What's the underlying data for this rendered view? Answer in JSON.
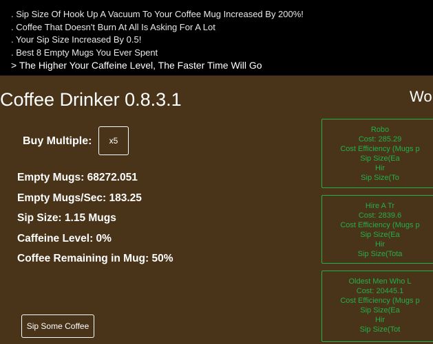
{
  "log": [
    ". Sip Size Of Hook Up A Vacuum To Your Coffee Mug Increased By 200%!",
    ". Coffee That Doesn't Burn At All Is Asking For A Lot",
    ". Your Sip Size Increased By 0.5!",
    ". Best 8 Empty Mugs You Ever Spent",
    "> The Higher Your Caffeine Level, The Faster Time Will Go"
  ],
  "game_title": "Coffee Drinker 0.8.3.1",
  "workers_title": "Wo",
  "buy_multiple": {
    "label": "Buy Multiple:",
    "value": "x5"
  },
  "stats": {
    "empty_mugs": "Empty Mugs: 68272.051",
    "empty_mugs_per_sec": "Empty Mugs/Sec: 183.25",
    "sip_size": "Sip Size: 1.15 Mugs",
    "caffeine_level": "Caffeine Level: 0%",
    "coffee_remaining": "Coffee Remaining in Mug: 50%"
  },
  "sip_button_label": "Sip Some Coffee",
  "workers": [
    {
      "name": "Robo",
      "cost": "Cost: 285.29",
      "efficiency": "Cost Efficiency (Mugs p",
      "sip_each": "Sip Size(Ea",
      "hired": "Hir",
      "sip_total": "Sip Size(To"
    },
    {
      "name": "Hire A Tr",
      "cost": "Cost: 2839.6",
      "efficiency": "Cost Efficiency (Mugs p",
      "sip_each": "Sip Size(Ea",
      "hired": "Hir",
      "sip_total": "Sip Size(Tota"
    },
    {
      "name": "Oldest Men Who L",
      "cost": "Cost: 20445.1",
      "efficiency": "Cost Efficiency (Mugs p",
      "sip_each": "Sip Size(Ea",
      "hired": "Hir",
      "sip_total": "Sip Size(Tot"
    }
  ],
  "colors": {
    "background": "#4a3419",
    "log_background": "#000000",
    "worker_accent": "#22b04a"
  }
}
